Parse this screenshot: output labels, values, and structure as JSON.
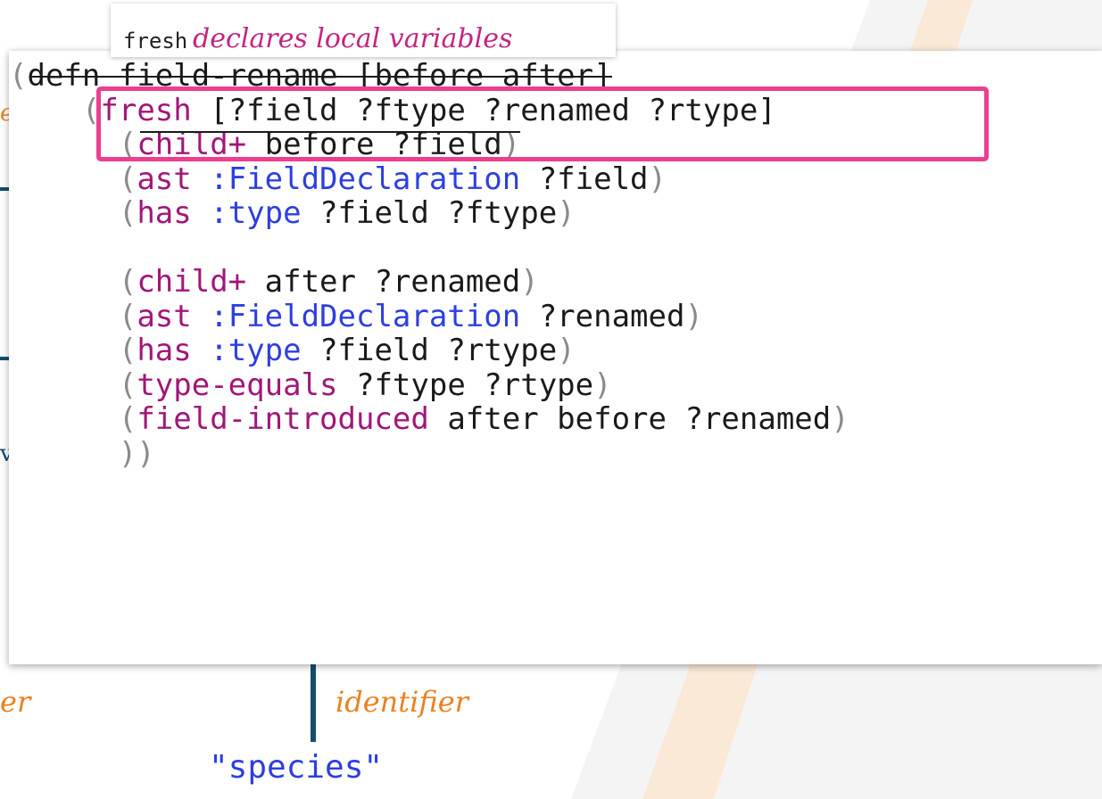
{
  "tooltip": {
    "code": "fresh",
    "note": "declares local variables"
  },
  "background": {
    "fragment_left": "e",
    "fragment_left_2": "v",
    "fragment_bottom_left": "er",
    "label_identifier": "identifier",
    "string_value": "\"species\""
  },
  "code": {
    "defn": "defn",
    "fn_name": "field-rename",
    "params": "[before after]",
    "fresh": "fresh",
    "fresh_vars": "[?field ?ftype ?renamed ?rtype]",
    "child_plus": "child+",
    "ast": "ast",
    "has": "has",
    "field_decl": ":FieldDeclaration",
    "type_kw": ":type",
    "type_equals": "type-equals",
    "field_introduced": "field-introduced",
    "before": "before",
    "after": "after",
    "var_field": "?field",
    "var_ftype": "?ftype",
    "var_renamed": "?renamed",
    "var_rtype": "?rtype"
  }
}
